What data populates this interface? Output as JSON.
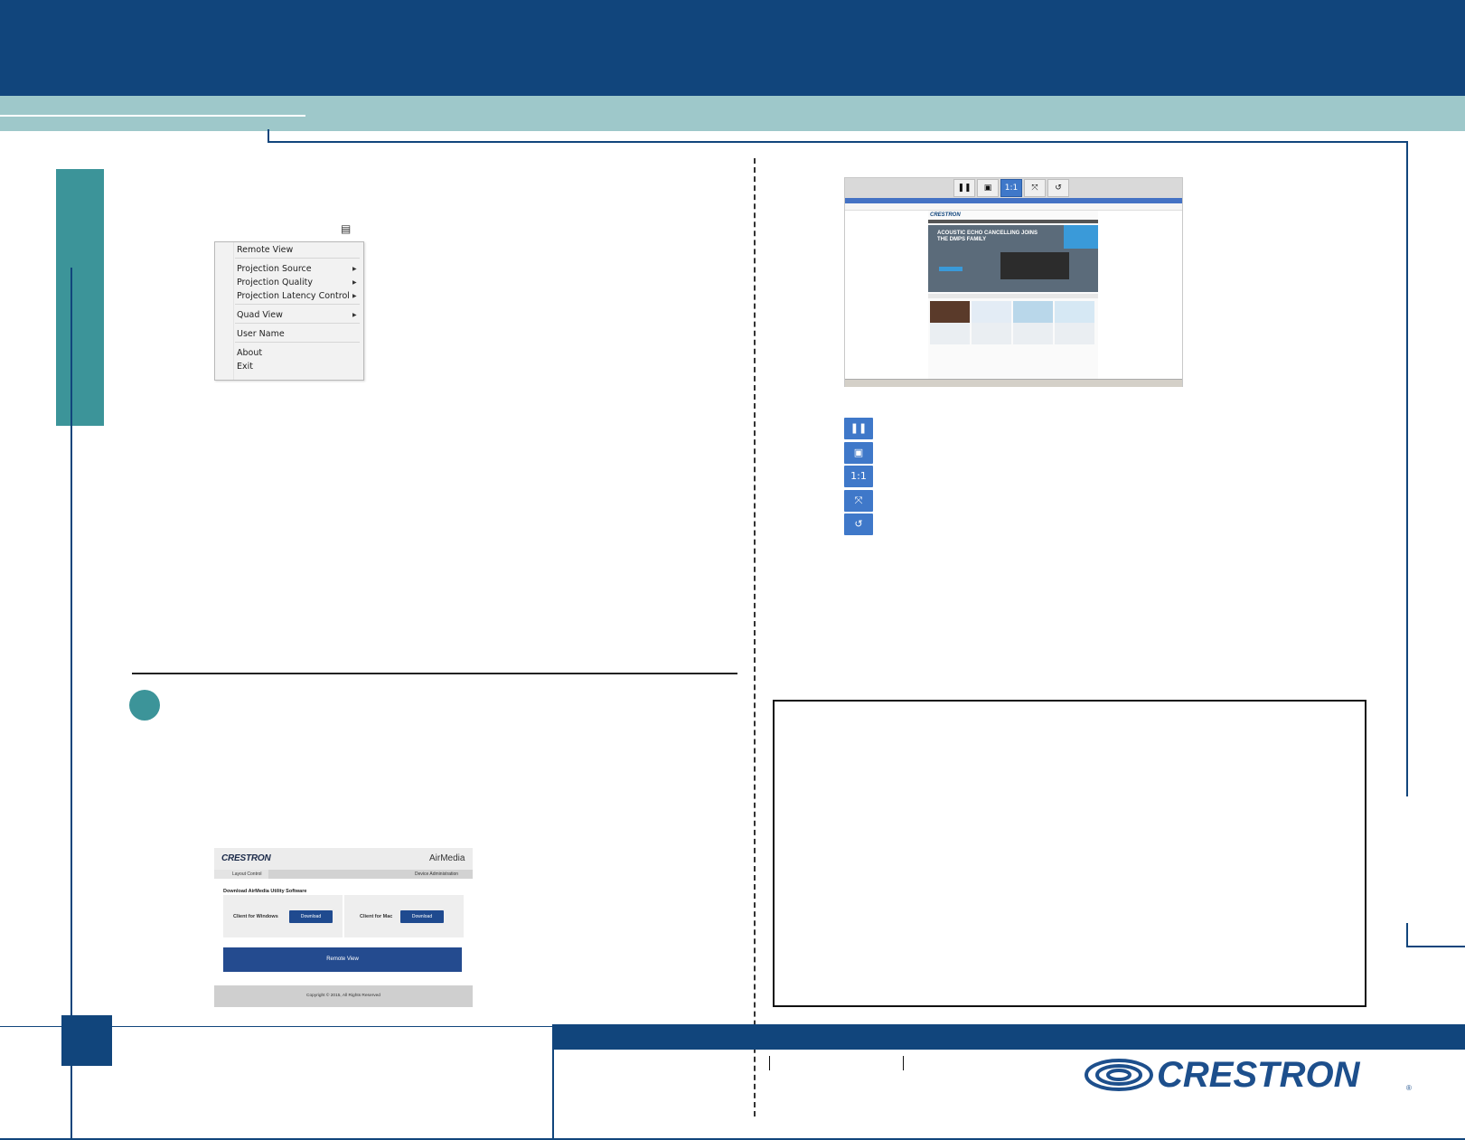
{
  "context_menu": {
    "items": [
      {
        "label": "Remote View",
        "submenu": false
      },
      {
        "label": "Projection Source",
        "submenu": true
      },
      {
        "label": "Projection Quality",
        "submenu": true
      },
      {
        "label": "Projection Latency Control",
        "submenu": true
      },
      {
        "label": "Quad View",
        "submenu": true
      },
      {
        "label": "User Name",
        "submenu": false
      },
      {
        "label": "About",
        "submenu": false
      },
      {
        "label": "Exit",
        "submenu": false
      }
    ],
    "trigger_icon": "menu-icon"
  },
  "remote_view_screenshot": {
    "toolbar_buttons": [
      "pause",
      "save",
      "1:1",
      "fit",
      "rotate"
    ],
    "toolbar_glyphs": [
      "❚❚",
      "▣",
      "1:1",
      "⤧",
      "↺"
    ],
    "site_logo": "CRESTRON",
    "hero_headline": "ACOUSTIC ECHO CANCELLING JOINS THE DMPS FAMILY"
  },
  "button_legend": [
    {
      "icon": "pause-icon",
      "glyph": "❚❚"
    },
    {
      "icon": "save-icon",
      "glyph": "▣"
    },
    {
      "icon": "actual-size-icon",
      "glyph": "1:1"
    },
    {
      "icon": "fit-screen-icon",
      "glyph": "⤧"
    },
    {
      "icon": "rotate-icon",
      "glyph": "↺"
    }
  ],
  "airmedia_page": {
    "logo": "CRESTRON",
    "brand": "AirMedia",
    "tabs": {
      "left": "Layout Control",
      "right": "Device Administration"
    },
    "section_title": "Download AirMedia Utility Software",
    "windows_label": "Client for Windows",
    "mac_label": "Client for Mac",
    "download_label": "Download",
    "remote_view_label": "Remote View",
    "footer": "Copyright © 2015, All Rights Reserved"
  },
  "footer": {
    "logo": "CRESTRON",
    "trademark": "®"
  },
  "colors": {
    "navy": "#11457c",
    "teal": "#3c9499",
    "light_teal": "#9ec8ca",
    "button_blue": "#3f78c9"
  }
}
